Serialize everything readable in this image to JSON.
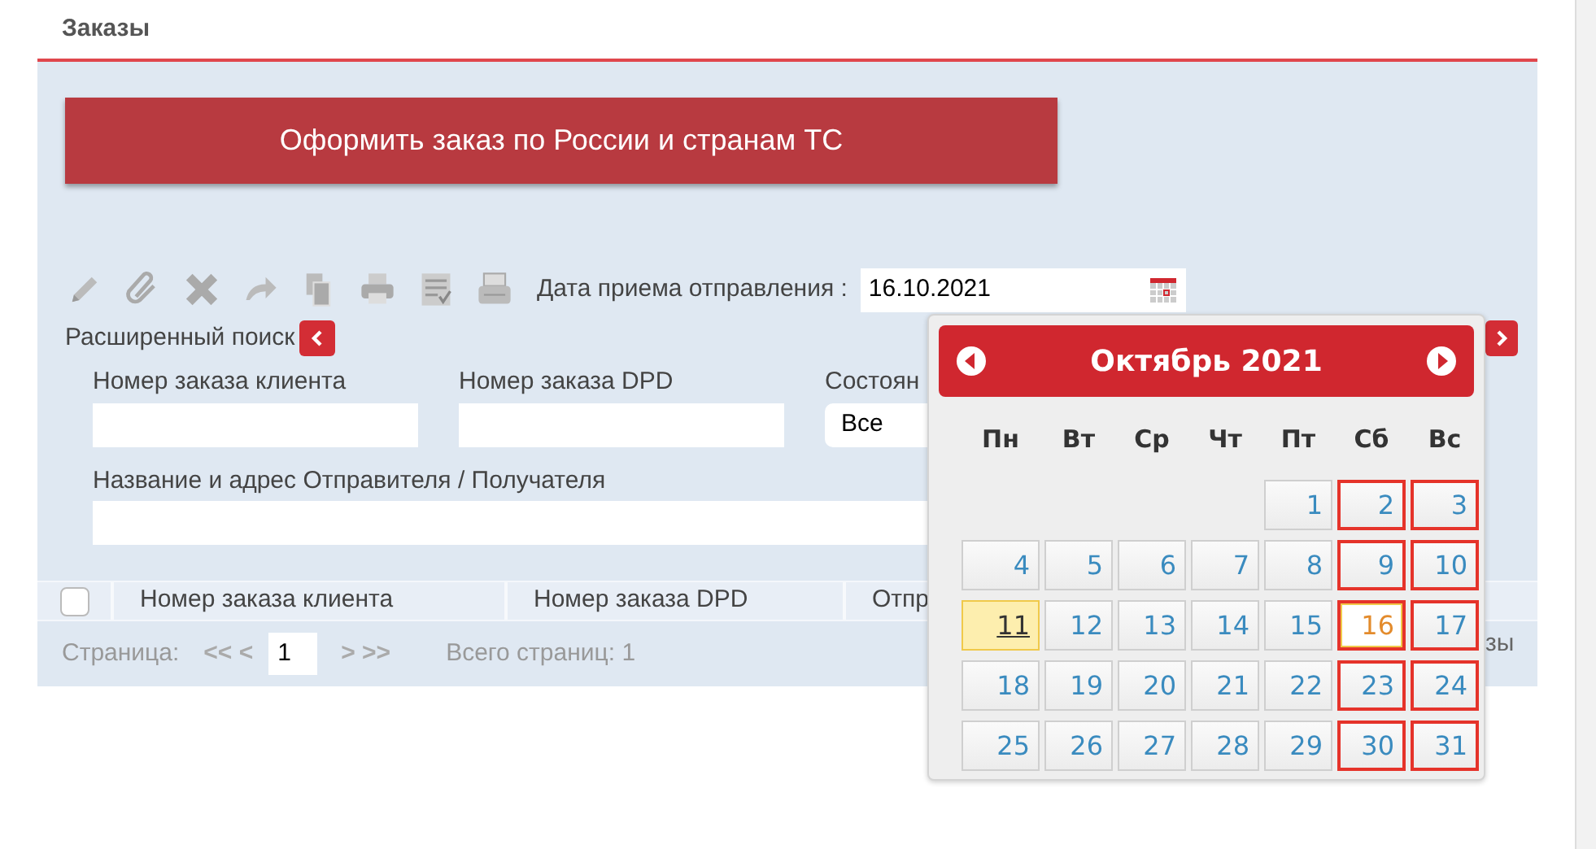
{
  "page_title": "Заказы",
  "create_button": "Оформить заказ по России и странам ТС",
  "date_filter": {
    "label": "Дата приема отправления :",
    "value": "16.10.2021"
  },
  "advanced_search": {
    "label": "Расширенный поиск",
    "expanded": true
  },
  "filters": [
    {
      "label": "Номер заказа клиента"
    },
    {
      "label": "Номер заказа DPD"
    }
  ],
  "state_filter": {
    "label": "Состоян",
    "value": "Все"
  },
  "name_filter": {
    "label": "Название и адрес Отправителя / Получателя"
  },
  "table": {
    "columns": [
      "Номер заказа клиента",
      "Номер заказа DPD",
      "Отпр"
    ],
    "select_all": {
      "checked": false
    }
  },
  "pager": {
    "label": "Страница:",
    "prev": "<< <",
    "page": "1",
    "next": "> >>",
    "total": "Всего страниц: 1",
    "column_3": "зы"
  },
  "calendar": {
    "title": "Октябрь 2021",
    "weekdays": [
      "Пн",
      "Вт",
      "Ср",
      "Чт",
      "Пт",
      "Сб",
      "Вс"
    ],
    "weeks": [
      [
        {
          "day": "1",
          "weekend": false,
          "today": false,
          "selected": false
        },
        {
          "day": "2",
          "weekend": true,
          "today": false,
          "selected": false
        },
        {
          "day": "3",
          "weekend": true,
          "today": false,
          "selected": false
        }
      ],
      [
        {
          "day": "4",
          "weekend": false,
          "today": false,
          "selected": false
        },
        {
          "day": "5",
          "weekend": false,
          "today": false,
          "selected": false
        },
        {
          "day": "6",
          "weekend": false,
          "today": false,
          "selected": false
        },
        {
          "day": "7",
          "weekend": false,
          "today": false,
          "selected": false
        },
        {
          "day": "8",
          "weekend": false,
          "today": false,
          "selected": false
        },
        {
          "day": "9",
          "weekend": true,
          "today": false,
          "selected": false
        },
        {
          "day": "10",
          "weekend": true,
          "today": false,
          "selected": false
        }
      ],
      [
        {
          "day": "11",
          "weekend": false,
          "today": true,
          "selected": false
        },
        {
          "day": "12",
          "weekend": false,
          "today": false,
          "selected": false
        },
        {
          "day": "13",
          "weekend": false,
          "today": false,
          "selected": false
        },
        {
          "day": "14",
          "weekend": false,
          "today": false,
          "selected": false
        },
        {
          "day": "15",
          "weekend": false,
          "today": false,
          "selected": false
        },
        {
          "day": "16",
          "weekend": true,
          "today": false,
          "selected": true
        },
        {
          "day": "17",
          "weekend": true,
          "today": false,
          "selected": false
        }
      ],
      [
        {
          "day": "18",
          "weekend": false,
          "today": false,
          "selected": false
        },
        {
          "day": "19",
          "weekend": false,
          "today": false,
          "selected": false
        },
        {
          "day": "20",
          "weekend": false,
          "today": false,
          "selected": false
        },
        {
          "day": "21",
          "weekend": false,
          "today": false,
          "selected": false
        },
        {
          "day": "22",
          "weekend": false,
          "today": false,
          "selected": false
        },
        {
          "day": "23",
          "weekend": true,
          "today": false,
          "selected": false
        },
        {
          "day": "24",
          "weekend": true,
          "today": false,
          "selected": false
        }
      ],
      [
        {
          "day": "25",
          "weekend": false,
          "today": false,
          "selected": false
        },
        {
          "day": "26",
          "weekend": false,
          "today": false,
          "selected": false
        },
        {
          "day": "27",
          "weekend": false,
          "today": false,
          "selected": false
        },
        {
          "day": "28",
          "weekend": false,
          "today": false,
          "selected": false
        },
        {
          "day": "29",
          "weekend": false,
          "today": false,
          "selected": false
        },
        {
          "day": "30",
          "weekend": true,
          "today": false,
          "selected": false
        },
        {
          "day": "31",
          "weekend": true,
          "today": false,
          "selected": false
        }
      ]
    ]
  }
}
